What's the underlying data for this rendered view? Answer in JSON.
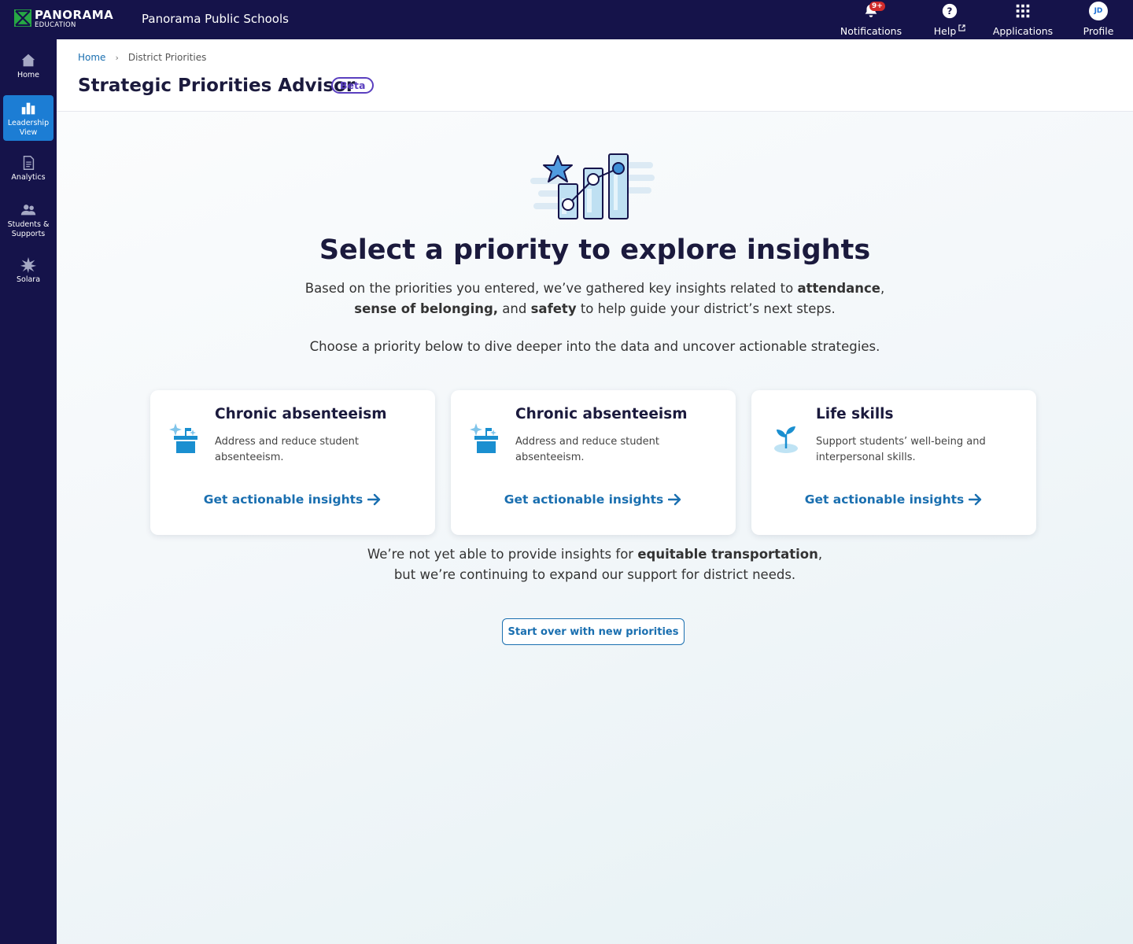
{
  "app": {
    "logo_name": "PANORAMA",
    "logo_sub": "EDUCATION",
    "district": "Panorama Public Schools"
  },
  "topnav": {
    "notifications": {
      "label": "Notifications",
      "badge": "9+",
      "icon": "bell-icon"
    },
    "help": {
      "label": "Help",
      "icon": "help-circle-icon"
    },
    "applications": {
      "label": "Applications",
      "icon": "grid-icon"
    },
    "profile": {
      "label": "Profile",
      "initials": "JD"
    }
  },
  "sidebar": {
    "items": [
      {
        "label": "Home",
        "icon": "house-icon"
      },
      {
        "label": "Leadership View",
        "icon": "bar-chart-icon",
        "active": true
      },
      {
        "label": "Analytics",
        "icon": "document-icon"
      },
      {
        "label": "Students & Supports",
        "icon": "people-icon"
      },
      {
        "label": "Solara",
        "icon": "starburst-icon"
      }
    ]
  },
  "breadcrumb": {
    "home": "Home",
    "sep": "›",
    "current": "District Priorities"
  },
  "page": {
    "title": "Strategic Priorities Advisor",
    "badge": "Beta"
  },
  "hero": {
    "headline": "Select a priority to explore insights",
    "intro_a": "Based on the priorities you entered, we’ve gathered key insights related to ",
    "intro_b1": "attendance",
    "intro_c": ",",
    "intro_b2": "sense of belonging,",
    "intro_d": " and ",
    "intro_b3": "safety",
    "intro_e": " to help guide your district’s next steps.",
    "intro2": "Choose a priority below to dive deeper into the data and uncover actionable strategies."
  },
  "cards": [
    {
      "title": "Chronic absenteeism",
      "desc": "Address and reduce student absenteeism.",
      "link": "Get actionable insights",
      "icon": "sparkle-box-icon"
    },
    {
      "title": "Chronic absenteeism",
      "desc": "Address and reduce student absenteeism.",
      "link": "Get actionable insights",
      "icon": "sparkle-box-icon"
    },
    {
      "title": "Life skills",
      "desc": "Support students’ well-being and interpersonal skills.",
      "link": "Get actionable insights",
      "icon": "sprout-icon"
    }
  ],
  "note": {
    "a": "We’re not yet able to provide insights for ",
    "b": "equitable transportation",
    "c": ",",
    "d": "but we’re continuing to expand our support for district needs."
  },
  "start_over": "Start over with new priorities",
  "colors": {
    "nav": "#15134a",
    "active": "#1c7dd4",
    "link": "#1a6fb0",
    "beta": "#5a3fbf",
    "badge": "#d12b2b"
  }
}
